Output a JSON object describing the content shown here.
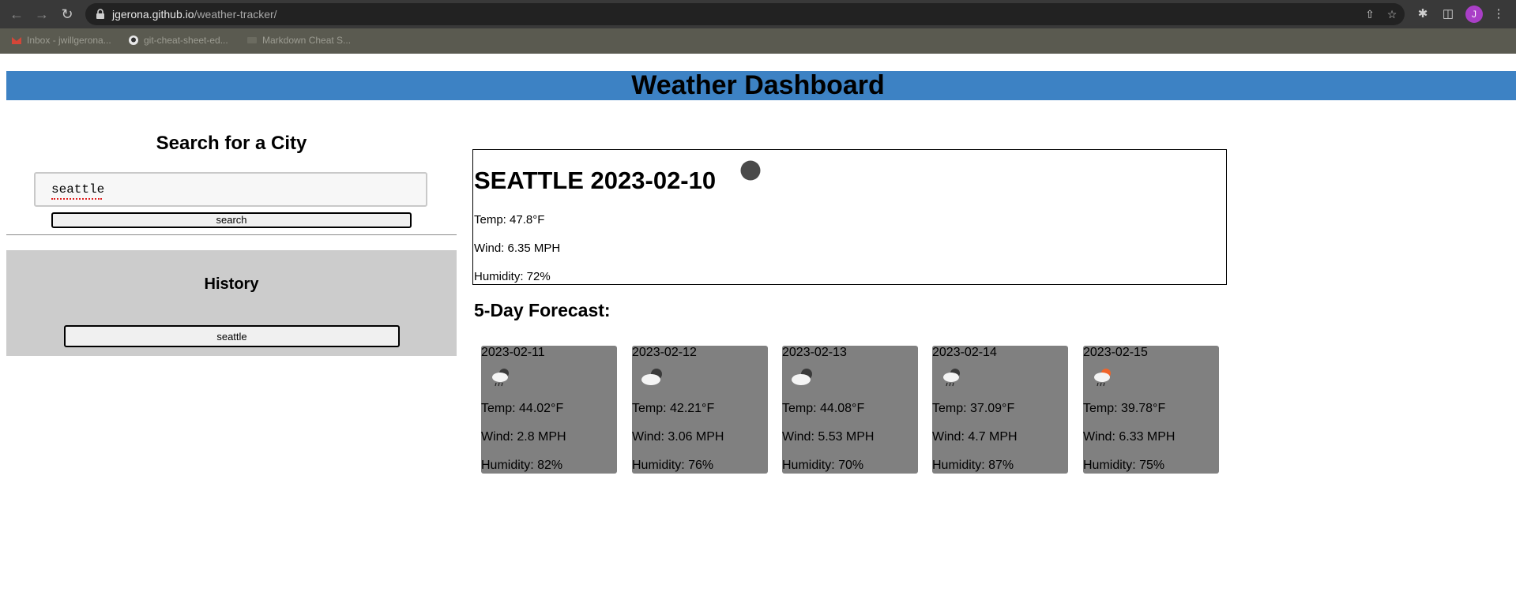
{
  "browser": {
    "url_host": "jgerona.github.io",
    "url_path": "/weather-tracker/",
    "profile_initial": "J",
    "bookmarks": [
      "Inbox - jwillgerona...",
      "git-cheat-sheet-ed...",
      "Markdown Cheat S..."
    ]
  },
  "header": {
    "title": "Weather Dashboard"
  },
  "search": {
    "title": "Search for a City",
    "input_value": "seattle",
    "button_label": "search"
  },
  "history": {
    "title": "History",
    "items": [
      "seattle"
    ]
  },
  "current": {
    "city_date": "SEATTLE 2023-02-10",
    "icon": "dark-circle-icon",
    "temp": "Temp: 47.8°F",
    "wind": "Wind: 6.35 MPH",
    "humidity": "Humidity: 72%"
  },
  "forecast": {
    "title": "5-Day Forecast:",
    "days": [
      {
        "date": "2023-02-11",
        "icon": "rain-cloud-icon",
        "temp": "Temp: 44.02°F",
        "wind": "Wind: 2.8 MPH",
        "humidity": "Humidity: 82%"
      },
      {
        "date": "2023-02-12",
        "icon": "cloudy-icon",
        "temp": "Temp: 42.21°F",
        "wind": "Wind: 3.06 MPH",
        "humidity": "Humidity: 76%"
      },
      {
        "date": "2023-02-13",
        "icon": "cloudy-icon",
        "temp": "Temp: 44.08°F",
        "wind": "Wind: 5.53 MPH",
        "humidity": "Humidity: 70%"
      },
      {
        "date": "2023-02-14",
        "icon": "rain-cloud-icon",
        "temp": "Temp: 37.09°F",
        "wind": "Wind: 4.7 MPH",
        "humidity": "Humidity: 87%"
      },
      {
        "date": "2023-02-15",
        "icon": "sun-rain-cloud-icon",
        "temp": "Temp: 39.78°F",
        "wind": "Wind: 6.33 MPH",
        "humidity": "Humidity: 75%"
      }
    ]
  },
  "colors": {
    "header_bar": "#3d82c4",
    "history_panel": "#cccccc",
    "forecast_card": "#808080"
  }
}
